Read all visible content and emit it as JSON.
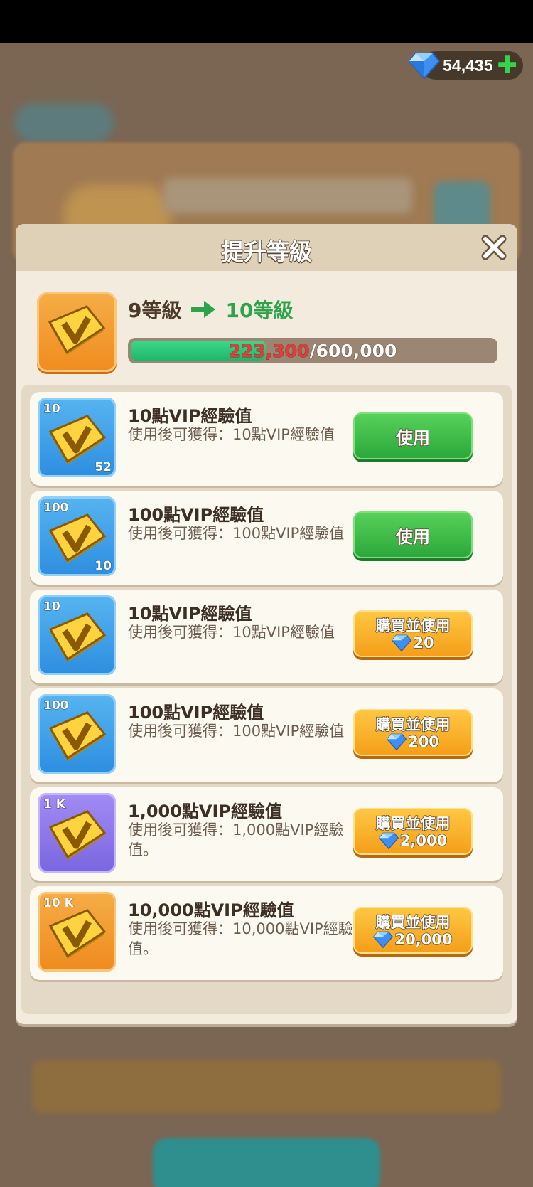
{
  "currency": {
    "gems": "54,435",
    "gem_icon": "diamond-icon",
    "add_icon": "plus-icon",
    "accent": "#37d24b"
  },
  "dialog": {
    "title": "提升等級",
    "close_icon": "close-icon",
    "level_from": "9等級",
    "level_to": "10等級",
    "xp_current": "223,300",
    "xp_total": "/600,000",
    "xp_progress": 0.372
  },
  "items": [
    {
      "badge": "10",
      "count": "52",
      "name": "10點VIP經驗值",
      "desc": "使用後可獲得：10點VIP經驗值",
      "button": "使用",
      "price": ""
    },
    {
      "badge": "100",
      "count": "10",
      "name": "100點VIP經驗值",
      "desc": "使用後可獲得：100點VIP經驗值",
      "button": "使用",
      "price": ""
    },
    {
      "badge": "10",
      "count": "",
      "name": "10點VIP經驗值",
      "desc": "使用後可獲得：10點VIP經驗值",
      "button": "購買並使用",
      "price": "20"
    },
    {
      "badge": "100",
      "count": "",
      "name": "100點VIP經驗值",
      "desc": "使用後可獲得：100點VIP經驗值",
      "button": "購買並使用",
      "price": "200"
    },
    {
      "badge": "1 K",
      "count": "",
      "name": "1,000點VIP經驗值",
      "desc": "使用後可獲得：1,000點VIP經驗值。",
      "button": "購買並使用",
      "price": "2,000"
    },
    {
      "badge": "10 K",
      "count": "",
      "name": "10,000點VIP經驗值",
      "desc": "使用後可獲得：10,000點VIP經驗值。",
      "button": "購買並使用",
      "price": "20,000"
    }
  ]
}
